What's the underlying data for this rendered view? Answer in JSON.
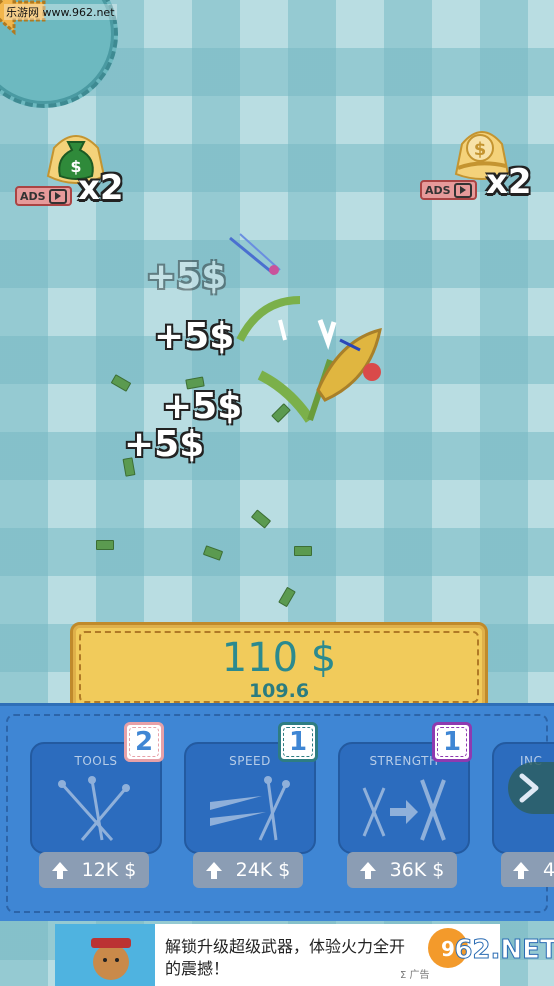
{
  "watermark": "乐游网 www.962.net",
  "boosts": {
    "left": {
      "ads_label": "ADS",
      "multiplier": "x2",
      "icon": "money-bag-icon"
    },
    "right": {
      "ads_label": "ADS",
      "multiplier": "x2",
      "icon": "dollar-hand-icon"
    }
  },
  "floating_gains": [
    "+5$",
    "+5$",
    "+5$",
    "+5$"
  ],
  "money": {
    "main": "110 $",
    "rate": "109.6"
  },
  "upgrades": [
    {
      "title": "TOOLS",
      "level": "2",
      "price": "12K $",
      "level_color": "#e7a1a8",
      "icon": "needles-icon"
    },
    {
      "title": "SPEED",
      "level": "1",
      "price": "24K $",
      "level_color": "#2e7d82",
      "icon": "speed-needles-icon"
    },
    {
      "title": "STRENGTH",
      "level": "1",
      "price": "36K $",
      "level_color": "#8e3ab0",
      "icon": "strength-icon"
    },
    {
      "title": "INC",
      "price": "4"
    }
  ],
  "ad": {
    "text": "解锁升级超级武器，体验火力全开的震撼！",
    "badge": "Σ 广告"
  },
  "brand_logo": {
    "text": "962.NET",
    "sub": "乐游网"
  }
}
